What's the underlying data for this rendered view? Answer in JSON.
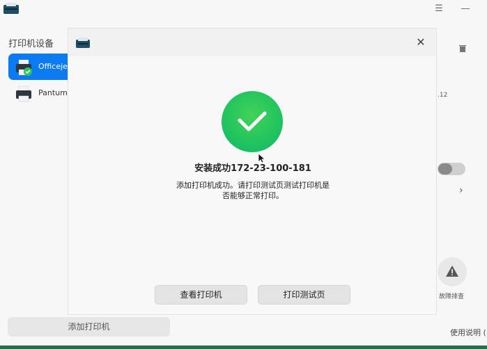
{
  "sidebar": {
    "title": "打印机设备",
    "devices": [
      {
        "label": "Officejet",
        "active": true
      },
      {
        "label": "Pantum-",
        "active": false
      }
    ],
    "add_label": "添加打印机"
  },
  "right_panel": {
    "ip_fragment": ".12",
    "troubleshoot_label": "故障排查",
    "help_label": "使用说明 ("
  },
  "dialog": {
    "title": "安装成功172-23-100-181",
    "description": "添加打印机成功。请打印测试页测试打印机是否能够正常打印。",
    "buttons": {
      "view": "查看打印机",
      "print_test": "打印测试页"
    }
  },
  "colors": {
    "accent": "#0a7bf3",
    "success": "#22c55e"
  }
}
